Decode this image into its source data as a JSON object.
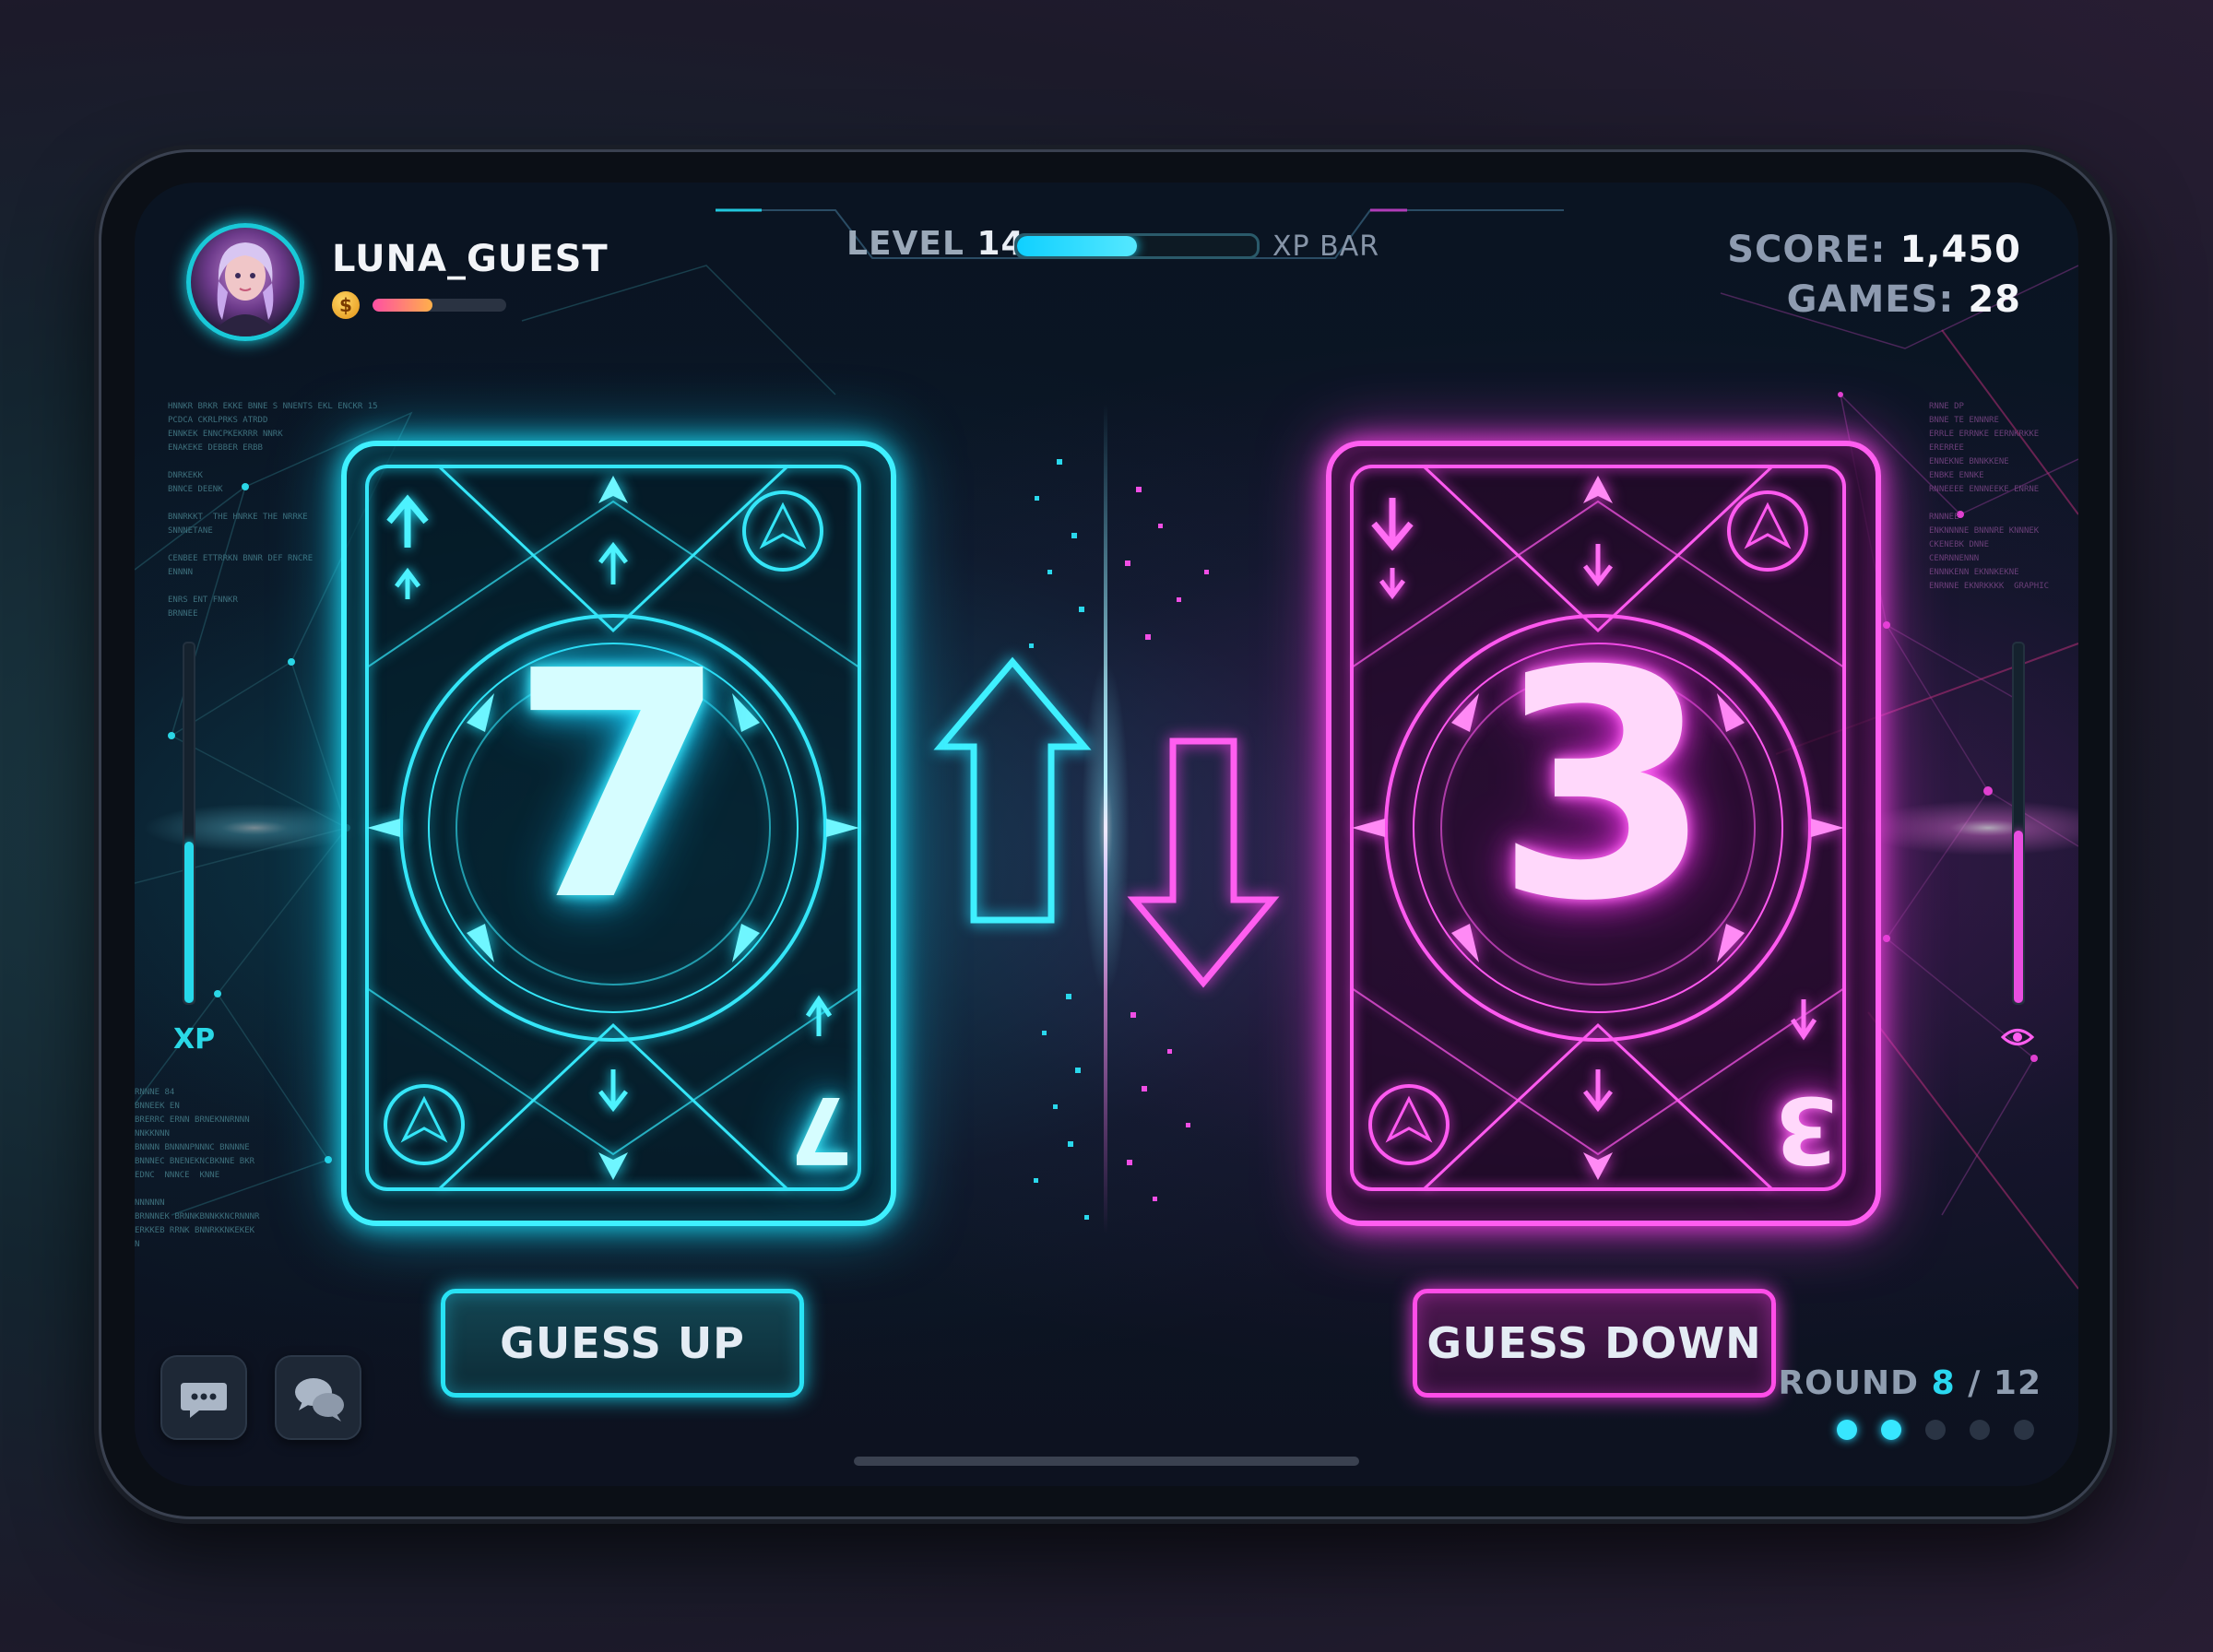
{
  "player": {
    "name": "LUNA_GUEST",
    "coin_icon": "$",
    "coin_progress": 0.45
  },
  "level": {
    "label": "LEVEL",
    "value": "14",
    "xp_progress": 0.5,
    "xp_bar_label": "XP BAR"
  },
  "stats": {
    "score_label": "SCORE:",
    "score_value": "1,450",
    "games_label": "GAMES:",
    "games_value": "28"
  },
  "side_meters": {
    "left_label": "XP",
    "left_level": 0.45,
    "right_level": 0.48,
    "right_icon": "eye-icon"
  },
  "cards": {
    "left": {
      "value": "7",
      "corner": "7",
      "color": "#3ff0ff"
    },
    "right": {
      "value": "3",
      "corner": "3",
      "color": "#ff5ef0"
    }
  },
  "buttons": {
    "guess_up": "GUESS UP",
    "guess_down": "GUESS DOWN"
  },
  "round": {
    "label": "ROUND",
    "current": "8",
    "separator": "/",
    "total": "12",
    "dots": [
      true,
      true,
      false,
      false,
      false
    ]
  },
  "icons": {
    "chat": "chat-bubble-icon",
    "multi_chat": "chat-bubbles-icon"
  },
  "colors": {
    "cyan": "#3ff0ff",
    "pink": "#ff5ef0",
    "accent": "#2ad8f0"
  }
}
